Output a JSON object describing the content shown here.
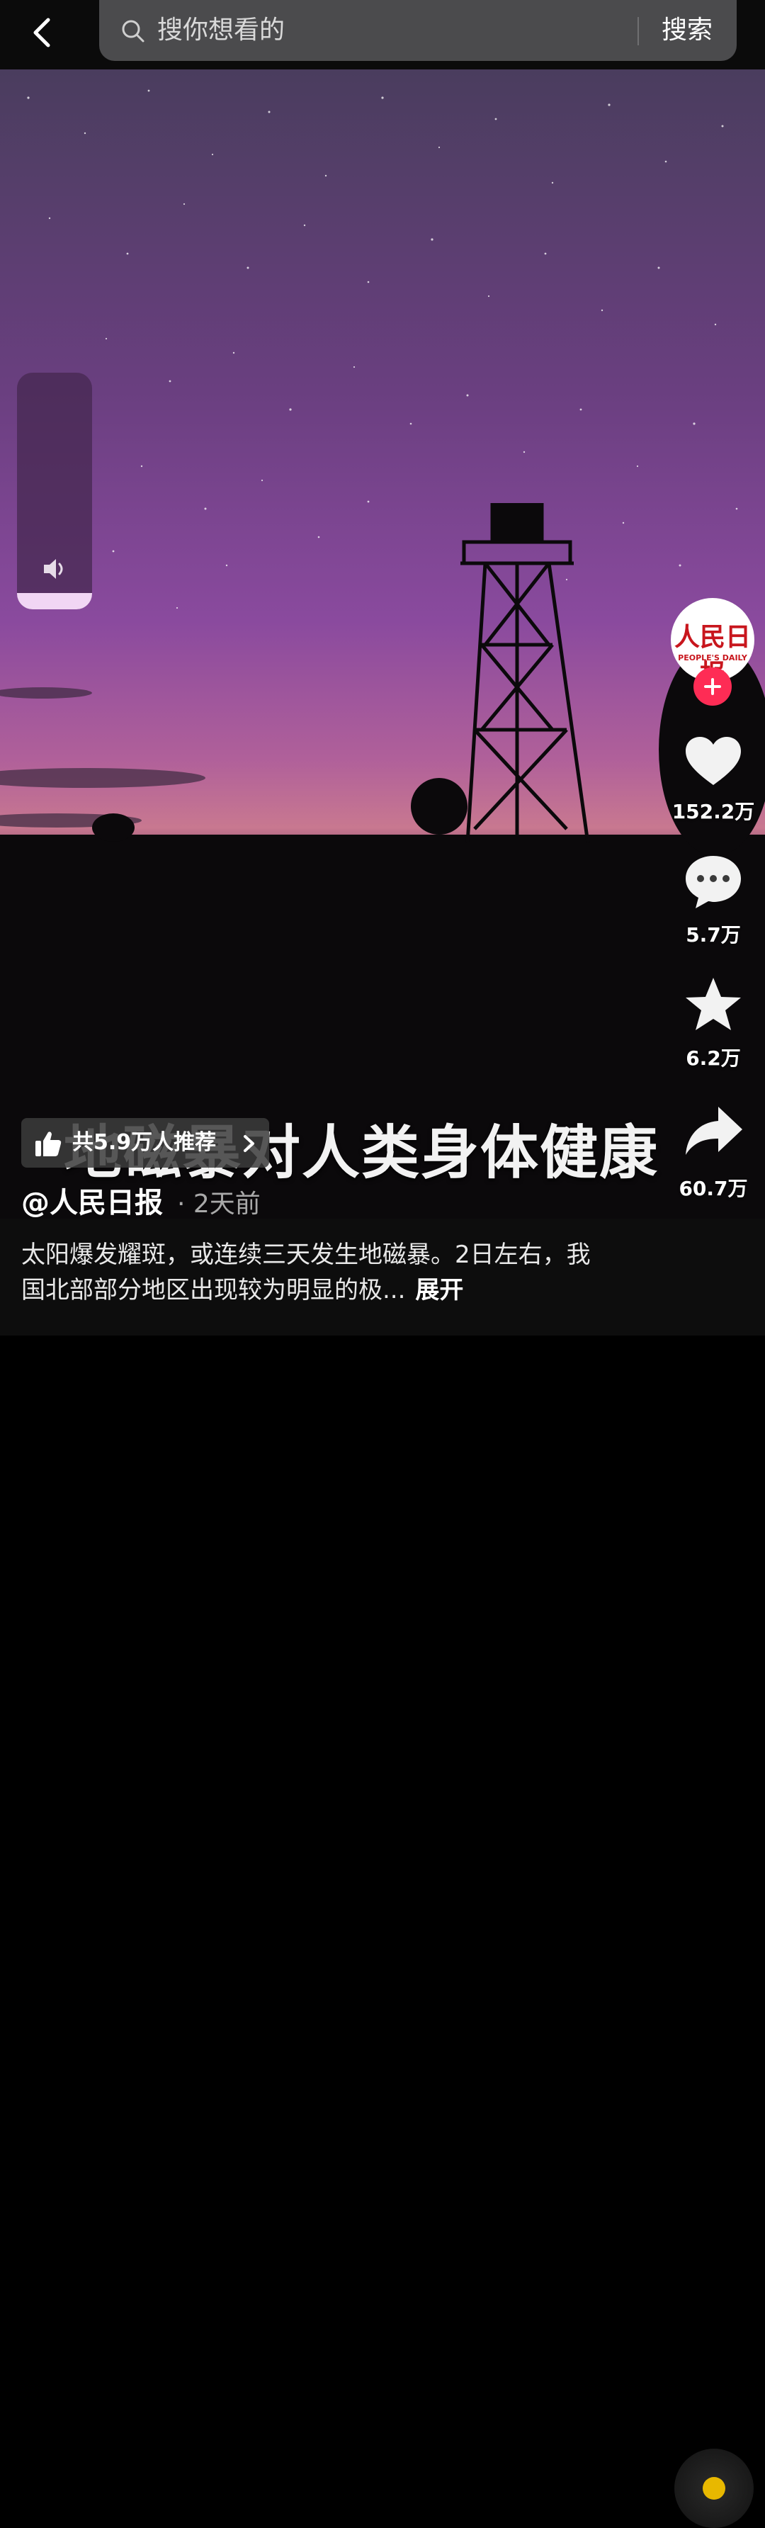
{
  "topbar": {
    "search_placeholder": "搜你想看的",
    "search_button": "搜索"
  },
  "video": {
    "caption": "地磁暴对人类身体健康"
  },
  "recommend": {
    "label": "共5.9万人推荐"
  },
  "author": {
    "handle": "@人民日报",
    "time": "· 2天前"
  },
  "description": {
    "text": "太阳爆发耀斑，或连续三天发生地磁暴。2日左右，我国北部部分地区出现较为明显的极...",
    "expand": "展开"
  },
  "sidebar": {
    "avatar_logo_text": "人民日报",
    "avatar_logo_sub": "PEOPLE'S DAILY",
    "likes": "152.2万",
    "comments": "5.7万",
    "favorites": "6.2万",
    "shares": "60.7万"
  },
  "volume": {
    "level": 0.07
  },
  "colors": {
    "follow": "#fe2c55",
    "brand_red": "#c8161d",
    "music_center": "#e8b800"
  }
}
